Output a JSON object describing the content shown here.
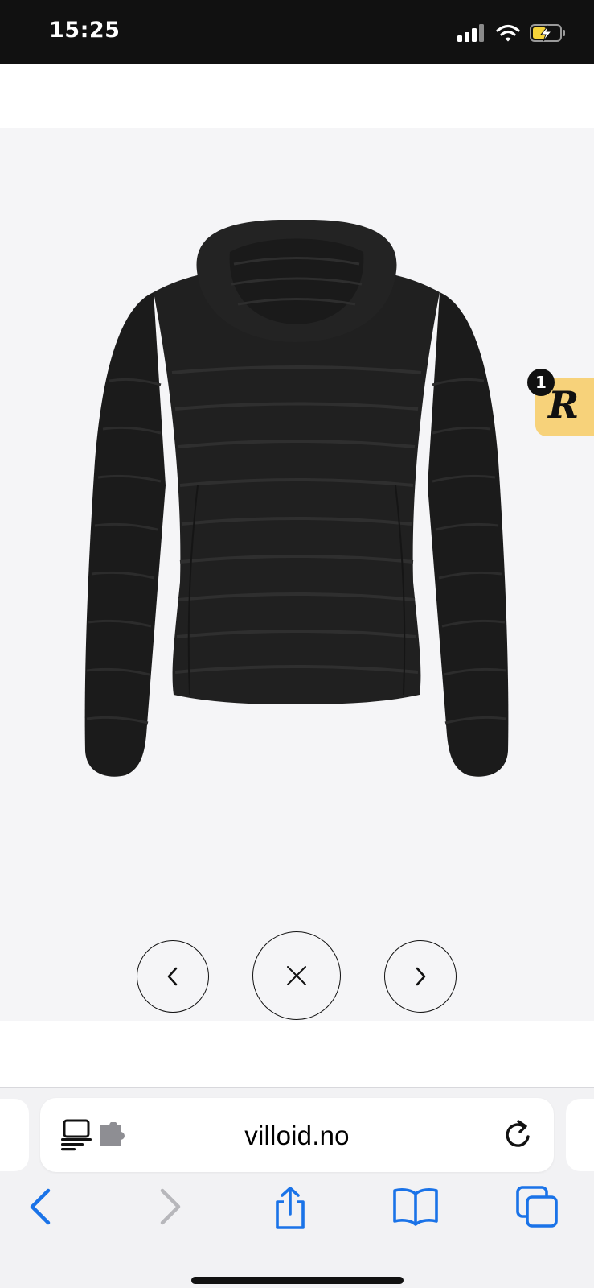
{
  "status_bar": {
    "time": "15:25"
  },
  "gallery": {
    "product_image": "black-puffer-jacket-back-view",
    "background": "#f5f5f7",
    "buttons": {
      "previous": "chevron-left-icon",
      "close": "close-icon",
      "next": "chevron-right-icon"
    }
  },
  "rewards_widget": {
    "letter": "R",
    "badge_count": "1",
    "color": "#f7d27a"
  },
  "browser": {
    "url": "villoid.no",
    "accent": "#1a73e8"
  }
}
